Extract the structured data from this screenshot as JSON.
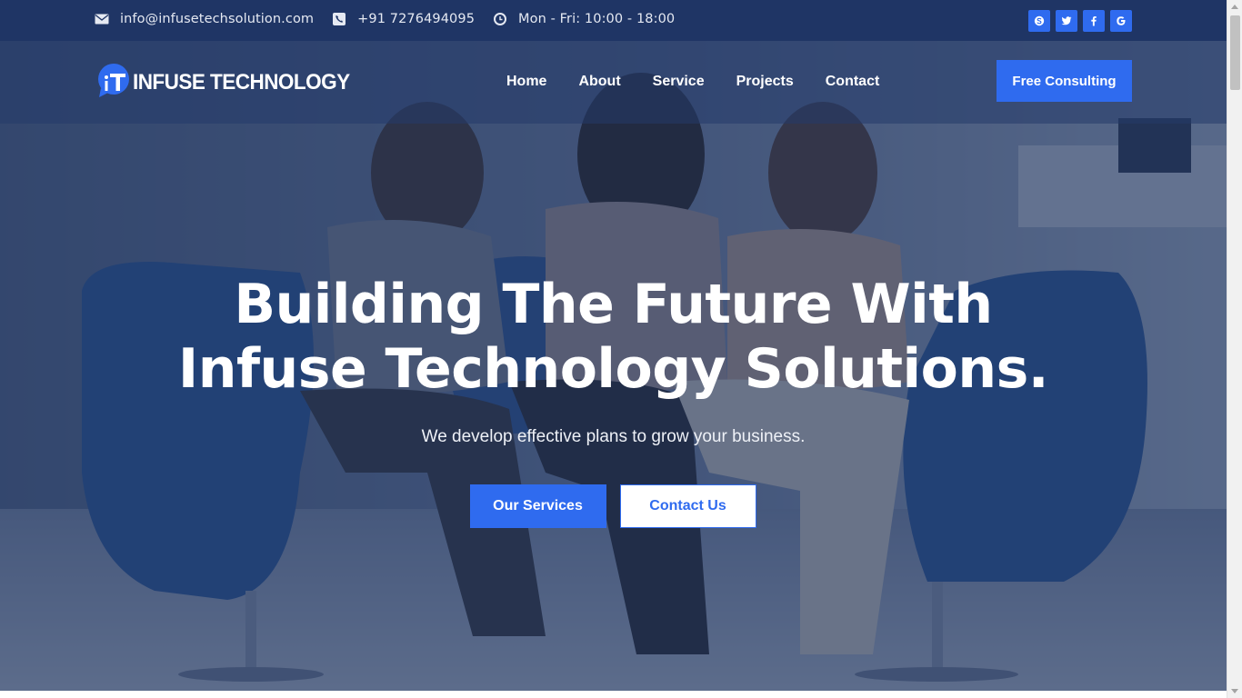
{
  "topbar": {
    "email": "info@infusetechsolution.com",
    "phone": "+91 7276494095",
    "hours": "Mon - Fri: 10:00 - 18:00",
    "socials": [
      {
        "name": "skype-icon"
      },
      {
        "name": "twitter-icon"
      },
      {
        "name": "facebook-icon"
      },
      {
        "name": "google-icon"
      }
    ]
  },
  "nav": {
    "logo_text": "INFUSE TECHNOLOGY",
    "logo_mark": "iT",
    "items": [
      {
        "label": "Home"
      },
      {
        "label": "About"
      },
      {
        "label": "Service"
      },
      {
        "label": "Projects"
      },
      {
        "label": "Contact"
      }
    ],
    "cta_label": "Free Consulting"
  },
  "hero": {
    "title_line1": "Building The Future With",
    "title_line2": "Infuse Technology Solutions.",
    "subtitle": "We develop effective plans to grow your business.",
    "primary_button": "Our Services",
    "secondary_button": "Contact Us"
  },
  "colors": {
    "brand_blue": "#2f6bef",
    "topbar_bg": "#1f3565",
    "overlay": "#1c2e56"
  }
}
